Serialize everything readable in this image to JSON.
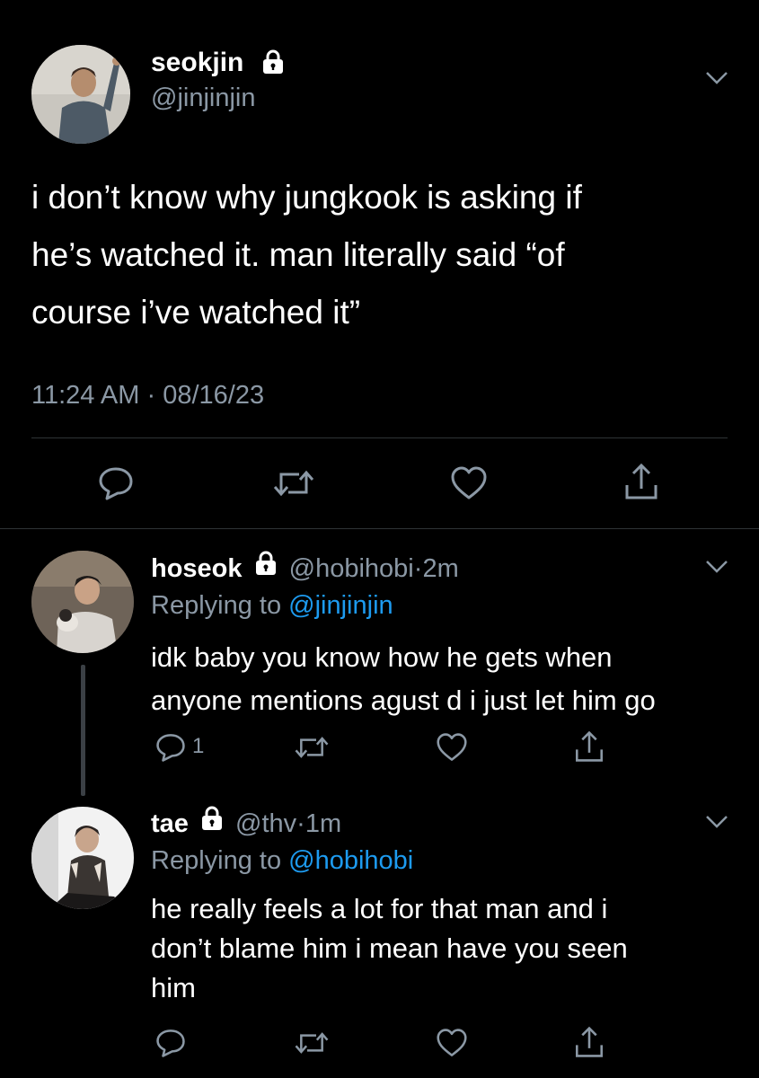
{
  "main_tweet": {
    "display_name": "seokjin",
    "handle": "@jinjinjin",
    "text_lines": [
      "i don’t know why jungkook is asking if",
      "he’s watched it. man literally said “of",
      "course i’ve watched it”"
    ],
    "time": "11:24 AM",
    "separator": "·",
    "date": "08/16/23",
    "icons": [
      "reply-icon",
      "retweet-icon",
      "like-icon",
      "share-icon"
    ]
  },
  "replies": [
    {
      "display_name": "hoseok",
      "handle": "@hobihobi",
      "age": "2m",
      "separator": "·",
      "replying_prefix": "Replying to",
      "replying_to": "@jinjinjin",
      "text_lines": [
        "idk baby you know how he gets when",
        "anyone mentions agust d i just let him go"
      ],
      "reply_count": "1"
    },
    {
      "display_name": "tae",
      "handle": "@thv",
      "age": "1m",
      "separator": "·",
      "replying_prefix": "Replying to",
      "replying_to": "@hobihobi",
      "text_lines": [
        "he really feels a lot for that man and i",
        "don’t blame him i mean have you seen",
        "him"
      ],
      "reply_count": ""
    }
  ],
  "colors": {
    "background": "#000000",
    "text": "#ffffff",
    "muted": "#8b98a5",
    "link": "#1d9bf0",
    "divider": "#2f3336"
  }
}
